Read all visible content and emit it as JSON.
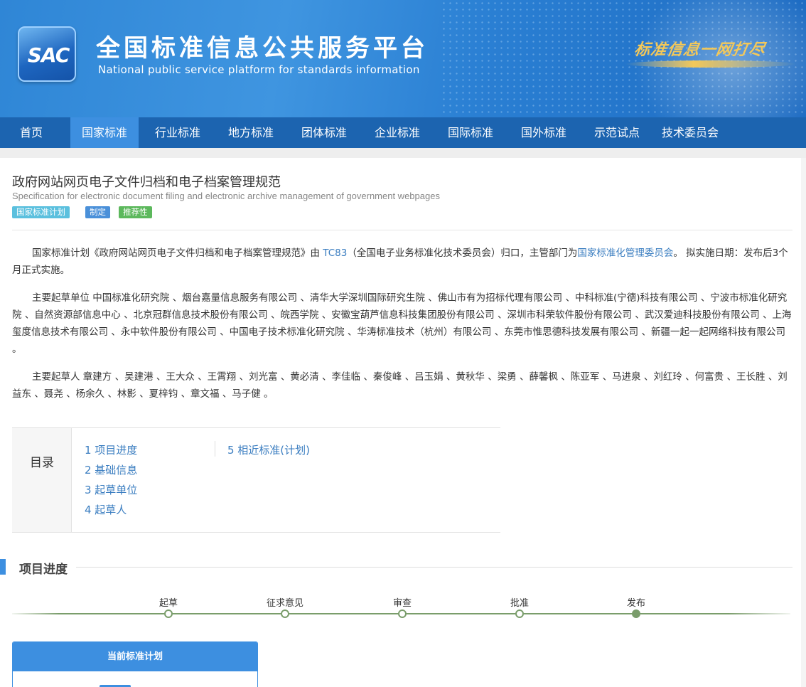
{
  "header": {
    "logo_text": "SAC",
    "title": "全国标准信息公共服务平台",
    "subtitle": "National public service platform  for standards information",
    "slogan": "标准信息一网打尽"
  },
  "nav": {
    "items": [
      {
        "label": "首页",
        "active": false
      },
      {
        "label": "国家标准",
        "active": true
      },
      {
        "label": "行业标准",
        "active": false
      },
      {
        "label": "地方标准",
        "active": false
      },
      {
        "label": "团体标准",
        "active": false
      },
      {
        "label": "企业标准",
        "active": false
      },
      {
        "label": "国际标准",
        "active": false
      },
      {
        "label": "国外标准",
        "active": false
      },
      {
        "label": "示范试点",
        "active": false
      },
      {
        "label": "技术委员会",
        "active": false
      }
    ]
  },
  "document": {
    "title": "政府网站网页电子文件归档和电子档案管理规范",
    "title_en": "Specification for electronic document filing and electronic archive management of government webpages",
    "badges": [
      {
        "label": "国家标准计划",
        "color": "#5bc0de"
      },
      {
        "label": "制定",
        "color": "#4a90d9"
      },
      {
        "label": "推荐性",
        "color": "#5cb85c"
      }
    ],
    "intro": {
      "prefix": "国家标准计划《政府网站网页电子文件归档和电子档案管理规范》由 ",
      "tc_link": "TC83",
      "middle": "（全国电子业务标准化技术委员会）归口，主管部门为",
      "dept_link": "国家标准化管理委员会",
      "suffix": "。 拟实施日期：发布后3个月正式实施。"
    },
    "drafting_units": "主要起草单位 中国标准化研究院 、烟台嘉量信息服务有限公司 、清华大学深圳国际研究生院 、佛山市有为招标代理有限公司 、中科标准(宁德)科技有限公司 、宁波市标准化研究院 、自然资源部信息中心 、北京冠群信息技术股份有限公司 、皖西学院 、安徽宝葫芦信息科技集团股份有限公司 、深圳市科荣软件股份有限公司 、武汉爱迪科技股份有限公司 、上海玺度信息技术有限公司 、永中软件股份有限公司 、中国电子技术标准化研究院 、华涛标准技术（杭州）有限公司 、东莞市惟思德科技发展有限公司 、新疆一起一起网络科技有限公司 。",
    "drafters": "主要起草人 章建方 、吴建港 、王大众 、王霄翔 、刘光富 、黄必清 、李佳临 、秦俊峰 、吕玉娟 、黄秋华 、梁勇 、薛馨枫 、陈亚军 、马进泉 、刘红玲 、何富贵 、王长胜 、刘益东 、聂尧 、杨余久 、林影 、夏梓钧 、章文福 、马子健 。"
  },
  "toc": {
    "label": "目录",
    "items": [
      "1  项目进度",
      "2  基础信息",
      "3  起草单位",
      "4  起草人",
      "5  相近标准(计划)"
    ]
  },
  "progress": {
    "section_title": "项目进度",
    "stages": [
      {
        "label": "起草",
        "done": false
      },
      {
        "label": "征求意见",
        "done": false
      },
      {
        "label": "审查",
        "done": false
      },
      {
        "label": "批准",
        "done": false
      },
      {
        "label": "发布",
        "done": true
      }
    ],
    "stage_color": "#7a9d6b"
  },
  "card": {
    "title": "当前标准计划"
  },
  "colors": {
    "brand_blue": "#1c64b0",
    "accent_blue": "#3d8fe0",
    "link_blue": "#3a7dc0"
  }
}
